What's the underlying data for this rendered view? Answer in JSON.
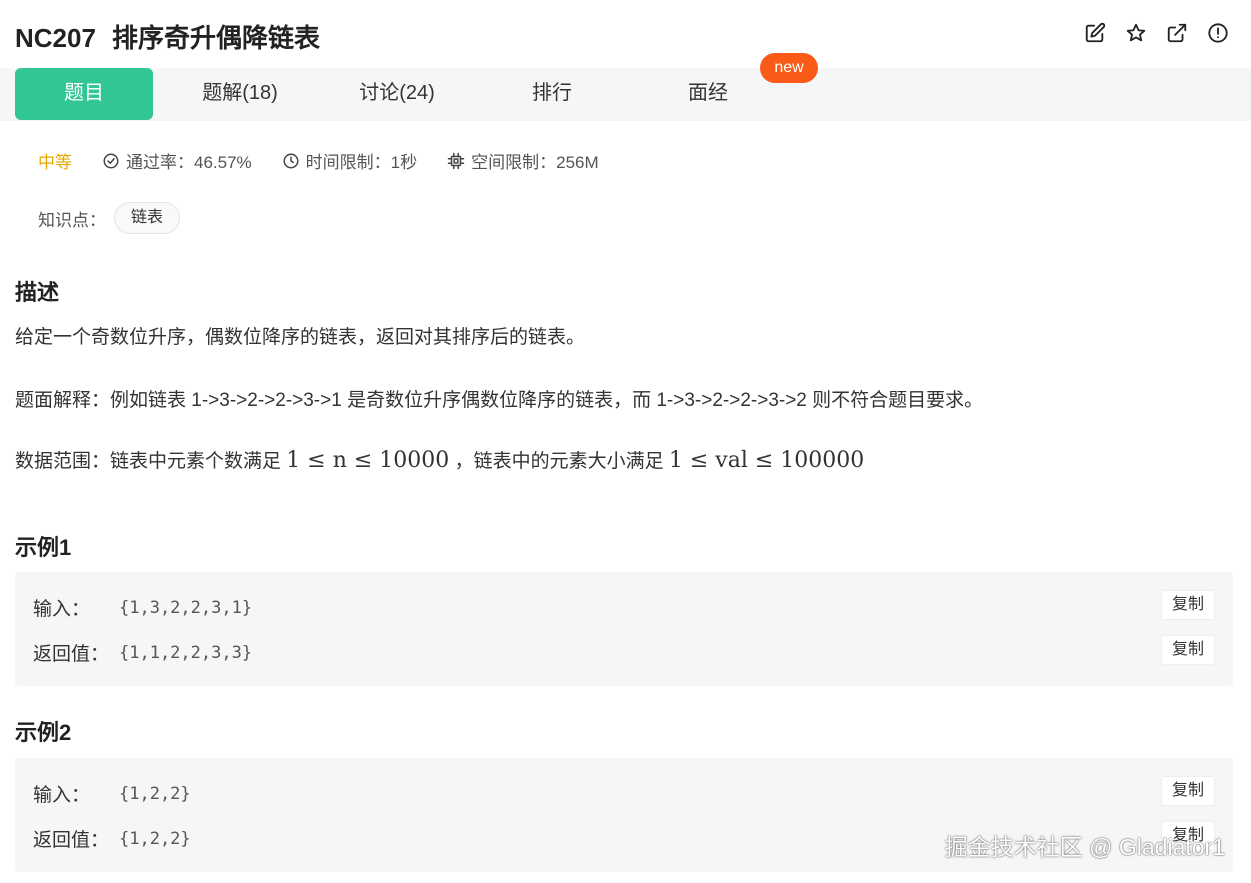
{
  "header": {
    "code": "NC207",
    "title": "排序奇升偶降链表",
    "icons": [
      "edit-icon",
      "star-icon",
      "share-icon",
      "report-icon"
    ]
  },
  "tabs": [
    {
      "label": "题目",
      "active": true
    },
    {
      "label": "题解(18)"
    },
    {
      "label": "讨论(24)"
    },
    {
      "label": "排行"
    },
    {
      "label": "面经"
    }
  ],
  "badge_new": "new",
  "meta": {
    "difficulty": "中等",
    "pass_rate": "通过率：46.57%",
    "time_limit": "时间限制：1秒",
    "space_limit": "空间限制：256M"
  },
  "knowledge": {
    "label": "知识点：",
    "tags": [
      "链表"
    ]
  },
  "description": {
    "heading": "描述",
    "line1": "给定一个奇数位升序，偶数位降序的链表，返回对其排序后的链表。",
    "line2": "题面解释：例如链表 1->3->2->2->3->1 是奇数位升序偶数位降序的链表，而 1->3->2->2->3->2 则不符合题目要求。",
    "line3_prefix": "数据范围：链表中元素个数满足",
    "line3_math1": "1 ≤ n ≤ 10000",
    "line3_mid": "，链表中的元素大小满足",
    "line3_math2": "1 ≤ val ≤ 100000"
  },
  "examples": [
    {
      "heading": "示例1",
      "input_label": "输入：",
      "input": "{1,3,2,2,3,1}",
      "output_label": "返回值：",
      "output": "{1,1,2,2,3,3}",
      "copy": "复制"
    },
    {
      "heading": "示例2",
      "input_label": "输入：",
      "input": "{1,2,2}",
      "output_label": "返回值：",
      "output": "{1,2,2}",
      "copy": "复制"
    }
  ],
  "watermark": "掘金技术社区 @ Gladiator1",
  "colors": {
    "accent": "#32c595",
    "new_badge": "#fa5a18",
    "difficulty": "#e5a900",
    "tab_bar_bg": "#f5f6f7",
    "example_bg": "#f5f6f7"
  }
}
